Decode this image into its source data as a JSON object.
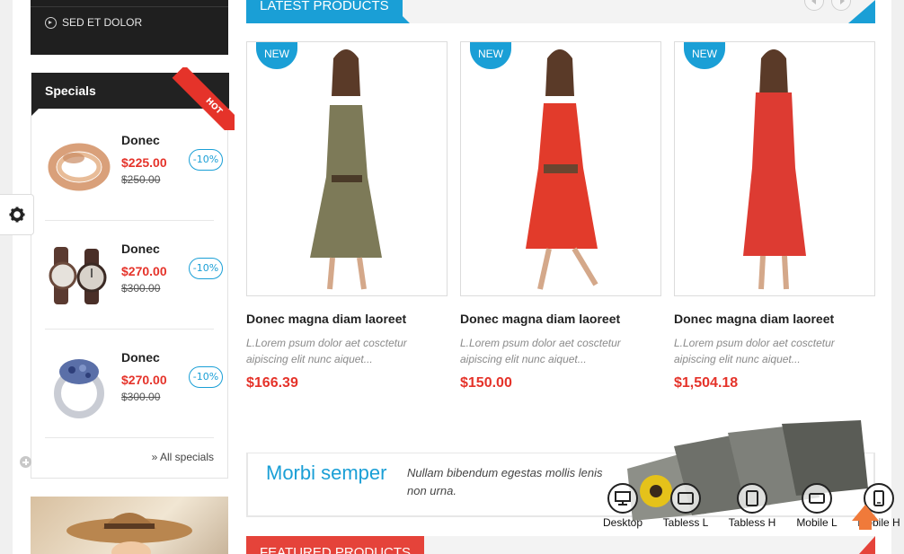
{
  "categories": {
    "item_label": "SED ET DOLOR"
  },
  "specials": {
    "title": "Specials",
    "hot_label": "HOT",
    "items": [
      {
        "name": "Donec",
        "price": "$225.00",
        "old_price": "$250.00",
        "discount": "-10%"
      },
      {
        "name": "Donec",
        "price": "$270.00",
        "old_price": "$300.00",
        "discount": "-10%"
      },
      {
        "name": "Donec",
        "price": "$270.00",
        "old_price": "$300.00",
        "discount": "-10%"
      }
    ],
    "all_link": "» All specials"
  },
  "latest": {
    "title": "LATEST PRODUCTS",
    "products": [
      {
        "badge": "NEW",
        "name": "Donec magna diam laoreet",
        "desc": "L.Lorem psum dolor aet cosctetur aipiscing elit nunc  aiquet...",
        "price": "$166.39",
        "dress_color": "#7d7a58"
      },
      {
        "badge": "NEW",
        "name": "Donec magna diam laoreet",
        "desc": "L.Lorem psum dolor aet cosctetur aipiscing elit nunc  aiquet...",
        "price": "$150.00",
        "dress_color": "#e23b2b"
      },
      {
        "badge": "NEW",
        "name": "Donec magna diam laoreet",
        "desc": "L.Lorem psum dolor aet cosctetur aipiscing elit nunc  aiquet...",
        "price": "$1,504.18",
        "dress_color": "#dd3b32"
      }
    ]
  },
  "promo": {
    "title": "Morbi semper",
    "text": "Nullam bibendum egestas mollis lenis non urna."
  },
  "featured": {
    "title": "FEATURED PRODUCTS"
  },
  "devices": [
    {
      "label": "Desktop",
      "icon": "desktop-icon"
    },
    {
      "label": "Tabless L",
      "icon": "tablet-landscape-icon"
    },
    {
      "label": "Tabless H",
      "icon": "tablet-portrait-icon"
    },
    {
      "label": "Mobile L",
      "icon": "mobile-landscape-icon"
    },
    {
      "label": "Mobile H",
      "icon": "mobile-portrait-icon"
    }
  ],
  "colors": {
    "accent": "#1a9fd6",
    "price": "#e5332a",
    "dark": "#1f1f1f"
  }
}
